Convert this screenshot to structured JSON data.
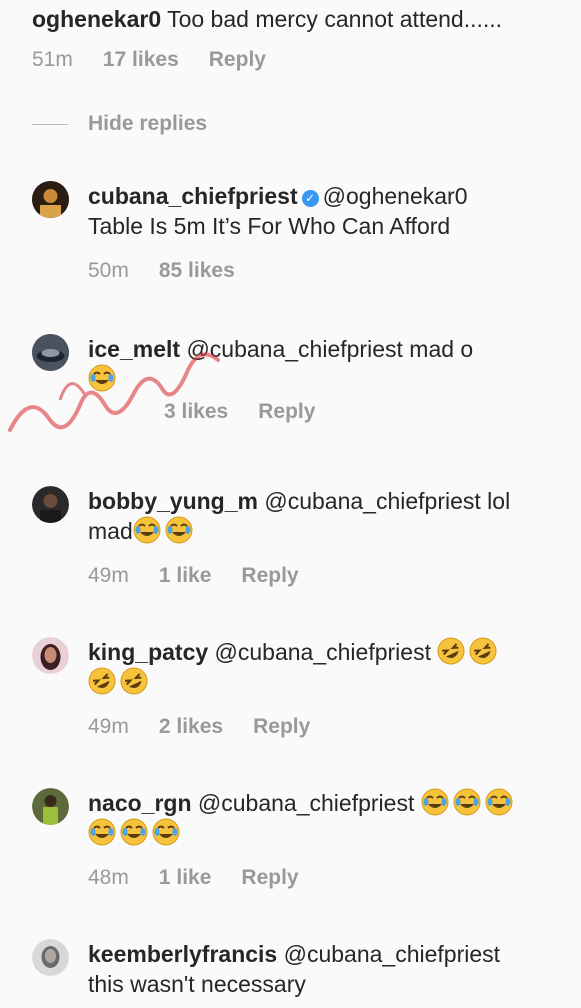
{
  "top_comment": {
    "username": "oghenekar0",
    "text": " Too bad mercy cannot attend......",
    "time": "51m",
    "likes": "17 likes",
    "reply_label": "Reply"
  },
  "hide_replies_label": "Hide replies",
  "replies": [
    {
      "username": "cubana_chiefpriest",
      "verified": true,
      "mention": "@oghenekar0",
      "text_line2": "Table Is 5m It’s For Who Can Afford",
      "time": "50m",
      "likes": "85 likes",
      "reply_label": ""
    },
    {
      "username": "ice_melt",
      "mention": "@cubana_chiefpriest",
      "text": " mad o",
      "time": "",
      "likes": "3 likes",
      "reply_label": "Reply"
    },
    {
      "username": "bobby_yung_m",
      "mention": "@cubana_chiefpriest",
      "text": " lol",
      "text_line2": "mad",
      "time": "49m",
      "likes": "1 like",
      "reply_label": "Reply"
    },
    {
      "username": "king_patcy",
      "mention": "@cubana_chiefpriest",
      "time": "49m",
      "likes": "2 likes",
      "reply_label": "Reply"
    },
    {
      "username": "naco_rgn",
      "mention": "@cubana_chiefpriest",
      "time": "48m",
      "likes": "1 like",
      "reply_label": "Reply"
    },
    {
      "username": "keemberlyfrancis",
      "mention": "@cubana_chiefpriest",
      "text_line2": "this wasn't necessary"
    }
  ],
  "icons": {
    "verified": "verified-badge-icon",
    "tears_of_joy": "face-with-tears-of-joy-emoji",
    "rofl": "rolling-on-floor-laughing-emoji"
  },
  "colors": {
    "background": "#fafafa",
    "text": "#262626",
    "meta": "#999999",
    "verified": "#3897f0",
    "emoji": "#f7c23c",
    "watermark": "#d9262c"
  }
}
